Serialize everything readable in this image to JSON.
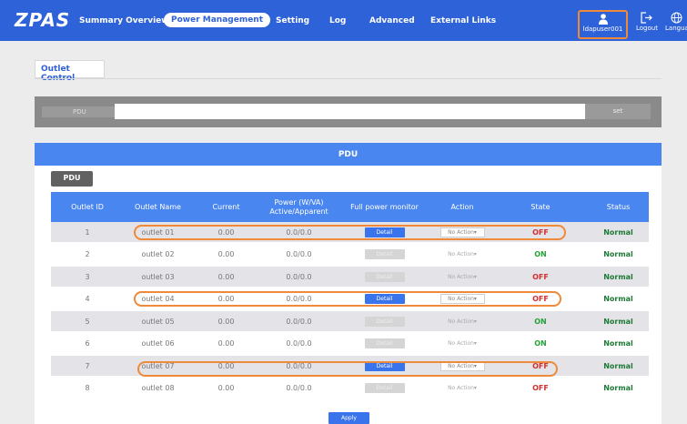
{
  "brand": {
    "logo": "ZPAS"
  },
  "nav": {
    "items": [
      {
        "label": "Summary Overview",
        "active": false
      },
      {
        "label": "Power Management",
        "active": true
      },
      {
        "label": "Setting",
        "active": false
      },
      {
        "label": "Log",
        "active": false
      },
      {
        "label": "Advanced",
        "active": false
      },
      {
        "label": "External Links",
        "active": false
      }
    ],
    "user": "ldapuser001",
    "logout": "Logout",
    "language": "Langua"
  },
  "page": {
    "tab": "Outlet Control",
    "pdu_bar": {
      "label": "PDU",
      "button": "set"
    },
    "section_title": "PDU",
    "pdu_chip": "PDU"
  },
  "table": {
    "headers": [
      "Outlet ID",
      "Outlet Name",
      "Current",
      "Power (W/VA)\nActive/Apparent",
      "Full power monitor",
      "Action",
      "State",
      "Status"
    ],
    "header_line1": "Power (W/VA)",
    "header_line2": "Active/Apparent",
    "rows": [
      {
        "id": "1",
        "name": "outlet 01",
        "current": "0.00",
        "power": "0.0/0.0",
        "detail": "Detail",
        "detail_enabled": true,
        "action": "No Action",
        "action_enabled": true,
        "state": "OFF",
        "status": "Normal"
      },
      {
        "id": "2",
        "name": "outlet 02",
        "current": "0.00",
        "power": "0.0/0.0",
        "detail": "Detail",
        "detail_enabled": false,
        "action": "No Action",
        "action_enabled": false,
        "state": "ON",
        "status": "Normal"
      },
      {
        "id": "3",
        "name": "outlet 03",
        "current": "0.00",
        "power": "0.0/0.0",
        "detail": "Detail",
        "detail_enabled": false,
        "action": "No Action",
        "action_enabled": false,
        "state": "OFF",
        "status": "Normal"
      },
      {
        "id": "4",
        "name": "outlet 04",
        "current": "0.00",
        "power": "0.0/0.0",
        "detail": "Detail",
        "detail_enabled": true,
        "action": "No Action",
        "action_enabled": true,
        "state": "OFF",
        "status": "Normal"
      },
      {
        "id": "5",
        "name": "outlet 05",
        "current": "0.00",
        "power": "0.0/0.0",
        "detail": "Detail",
        "detail_enabled": false,
        "action": "No Action",
        "action_enabled": false,
        "state": "ON",
        "status": "Normal"
      },
      {
        "id": "6",
        "name": "outlet 06",
        "current": "0.00",
        "power": "0.0/0.0",
        "detail": "Detail",
        "detail_enabled": false,
        "action": "No Action",
        "action_enabled": false,
        "state": "ON",
        "status": "Normal"
      },
      {
        "id": "7",
        "name": "outlet 07",
        "current": "0.00",
        "power": "0.0/0.0",
        "detail": "Detail",
        "detail_enabled": true,
        "action": "No Action",
        "action_enabled": true,
        "state": "OFF",
        "status": "Normal"
      },
      {
        "id": "8",
        "name": "outlet 08",
        "current": "0.00",
        "power": "0.0/0.0",
        "detail": "Detail",
        "detail_enabled": false,
        "action": "No Action",
        "action_enabled": false,
        "state": "OFF",
        "status": "Normal"
      }
    ]
  },
  "apply": "Apply",
  "colors": {
    "brand_blue": "#2e62d8",
    "header_blue": "#4a86f0",
    "highlight": "#ee8a3a",
    "on": "#27a03a",
    "off": "#d03030"
  }
}
